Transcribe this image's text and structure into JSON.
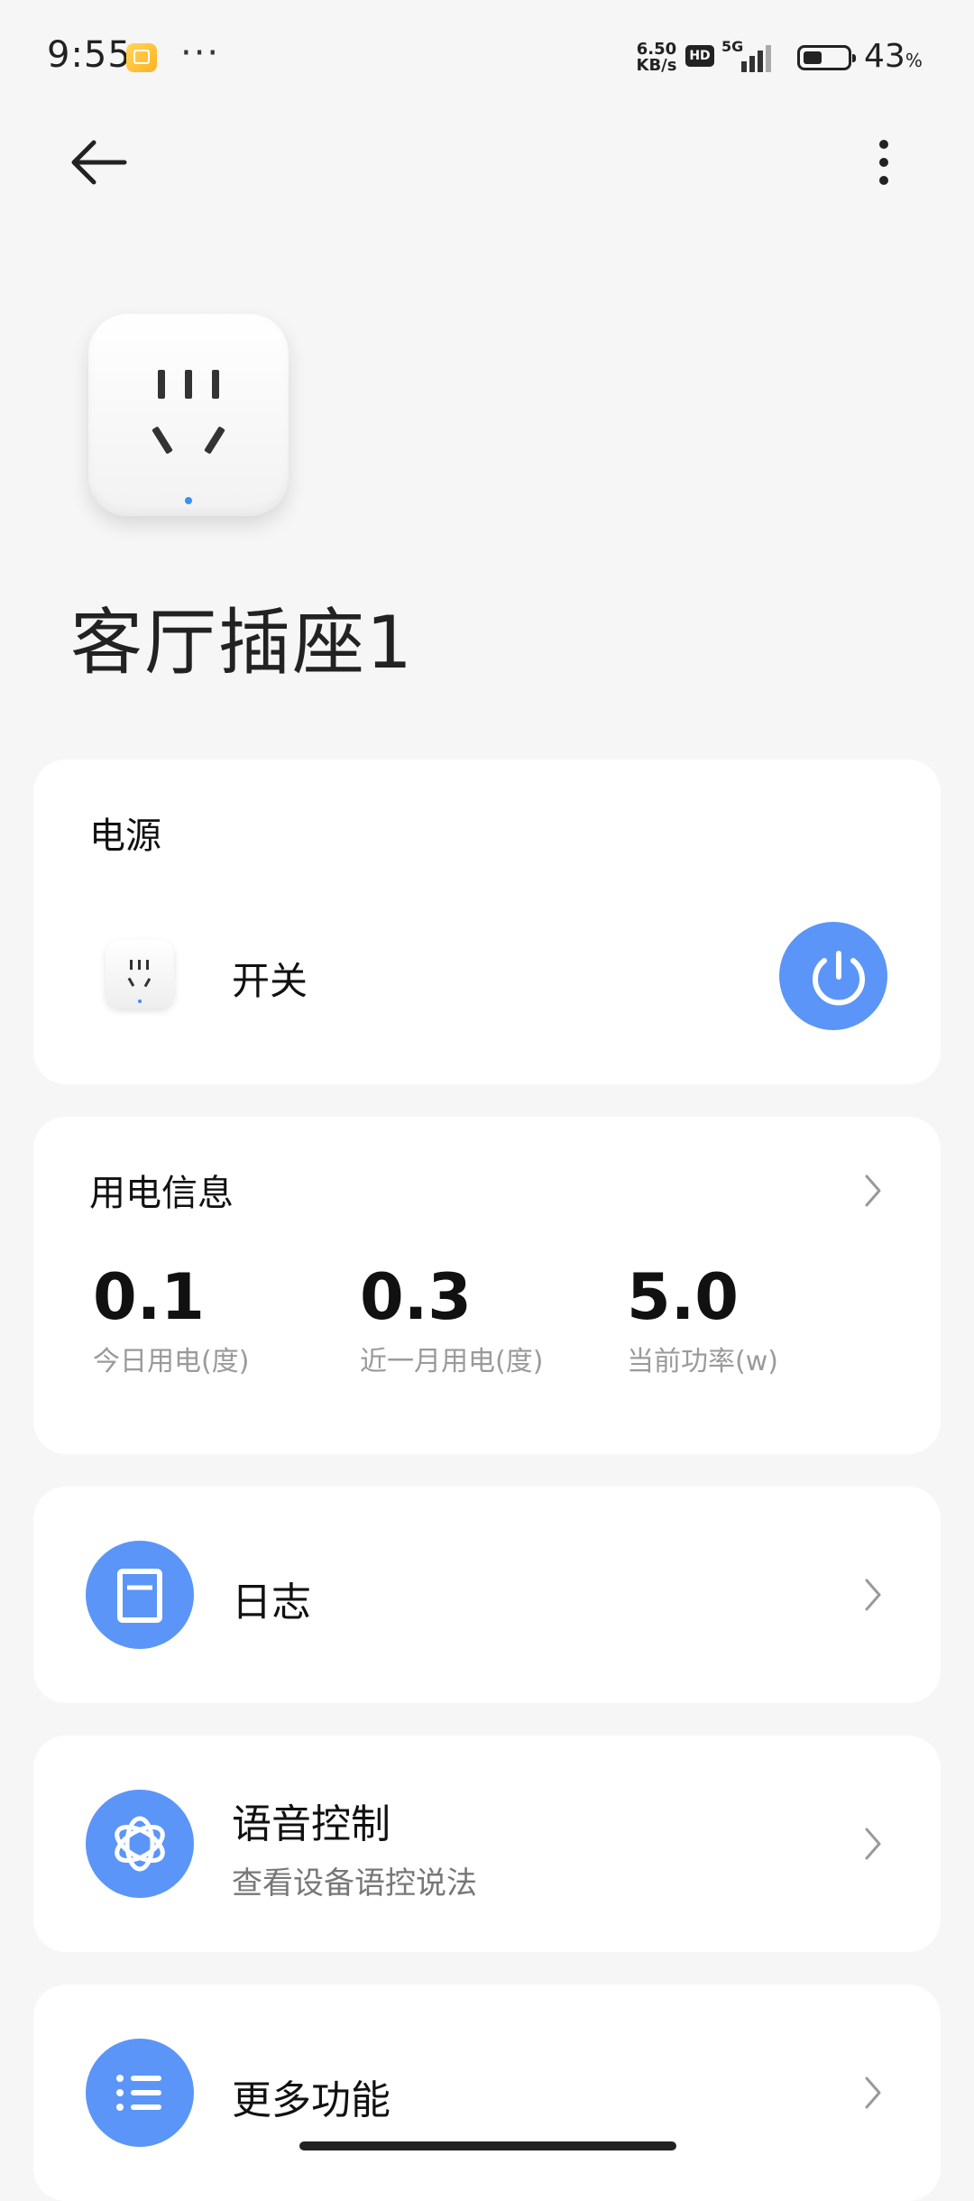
{
  "status_bar": {
    "time": "9:55",
    "more": "···",
    "net_speed_value": "6.50",
    "net_speed_unit": "KB/s",
    "hd": "HD",
    "network": "5G",
    "battery_level": 0.43,
    "battery_percent": "43",
    "battery_percent_sign": "%"
  },
  "header": {
    "back_icon": "arrow-left-icon",
    "menu_icon": "more-vertical-icon"
  },
  "device": {
    "name": "客厅插座1",
    "image": "smart-plug-icon"
  },
  "power_card": {
    "title": "电源",
    "switch_label": "开关",
    "switch_on": true,
    "accent": "#5b95f7"
  },
  "usage_card": {
    "title": "用电信息",
    "stats": [
      {
        "value": "0.1",
        "label": "今日用电(度)"
      },
      {
        "value": "0.3",
        "label": "近一月用电(度)"
      },
      {
        "value": "5.0",
        "label": "当前功率(w)"
      }
    ]
  },
  "rows": {
    "log": {
      "title": "日志",
      "icon": "log-book-icon"
    },
    "voice": {
      "title": "语音控制",
      "subtitle": "查看设备语控说法",
      "icon": "voice-assistant-icon"
    },
    "more": {
      "title": "更多功能",
      "icon": "list-icon"
    }
  }
}
